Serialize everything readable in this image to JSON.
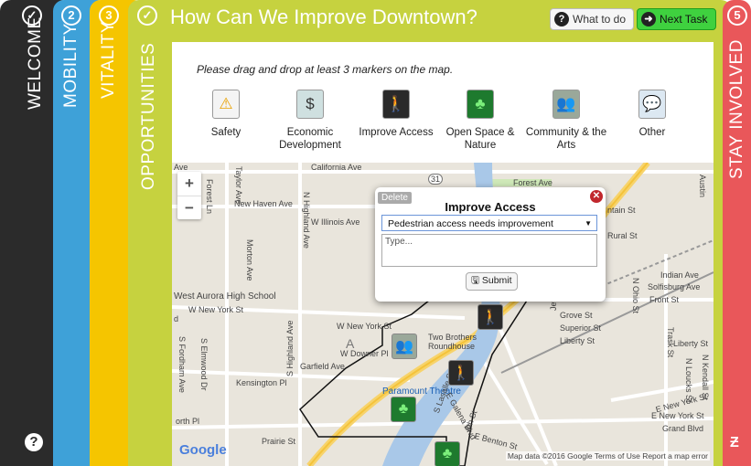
{
  "tabs": {
    "welcome": {
      "num": "✓",
      "label": "WELCOME"
    },
    "mobility": {
      "num": "2",
      "label": "MOBILITY"
    },
    "vitality": {
      "num": "3",
      "label": "VITALITY"
    },
    "opportunities": {
      "num": "✓",
      "label": "OPPORTUNITIES"
    },
    "stay": {
      "num": "5",
      "label": "STAY INVOLVED"
    }
  },
  "header": {
    "title": "How Can We Improve Downtown?",
    "what_to_do": "What to do",
    "next_task": "Next Task"
  },
  "instructions": "Please drag and drop at least 3 markers on the map.",
  "markers": [
    {
      "label": "Safety",
      "icon": "warning-icon"
    },
    {
      "label": "Economic Development",
      "icon": "dollar-icon"
    },
    {
      "label": "Improve Access",
      "icon": "pedestrian-icon"
    },
    {
      "label": "Open Space & Nature",
      "icon": "tree-icon"
    },
    {
      "label": "Community & the Arts",
      "icon": "people-icon"
    },
    {
      "label": "Other",
      "icon": "speech-bubble-icon"
    }
  ],
  "popup": {
    "delete": "Delete",
    "title": "Improve Access",
    "selected": "Pedestrian access needs improvement",
    "placeholder": "Type...",
    "submit": "Submit"
  },
  "map": {
    "zoom_in": "+",
    "zoom_out": "−",
    "labels": {
      "ave": "Ave",
      "taylor": "Taylor Ave",
      "forest_ln": "Forest Ln",
      "california": "California Ave",
      "route31": "31",
      "forest_ave": "Forest Ave",
      "austin": "Austin",
      "new_haven": "New Haven Ave",
      "n_highland": "N Highland Ave",
      "illinois": "W Illinois Ave",
      "ntain": "ntain St",
      "rural": "Rural St",
      "morton": "Morton Ave",
      "indian": "Indian Ave",
      "solfisburg": "Solfisburg Ave",
      "n_ohio": "N Ohio St",
      "front": "Front St",
      "west_aurora": "West Aurora High School",
      "w_new_york_1": "W New York St",
      "d": "d",
      "w_new_york_2": "W New York St",
      "grove": "Grove St",
      "superior": "Superior St",
      "liberty_1": "Liberty St",
      "jefferson": "Jefferson St",
      "trask": "Trask St",
      "liberty_2": "Liberty St",
      "s_fordham": "S Fordham Ave",
      "s_elmwood": "S Elmwood Dr",
      "w_downer": "W Downer Pl",
      "two_brothers": "Two Brothers Roundhouse",
      "garfield": "Garfield Ave",
      "a": "A",
      "n_kendall": "N Kendall St",
      "n_loucks": "N Loucks St",
      "kensington": "Kensington Pl",
      "s_highland": "S Highland Ave",
      "paramount": "Paramount Theatre",
      "e_new_york": "E New York St",
      "e_new_york_2": "E New York St",
      "grand": "Grand Blvd",
      "orth_pl": "orth Pl",
      "prairie": "Prairie St",
      "s_lasalle": "S Lasalle St",
      "e_galena": "E Galena Blvd",
      "fourth": "4th St",
      "e_benton": "E Benton St"
    },
    "google": "Google",
    "footer": "Map data ©2016 Google   Terms of Use   Report a map error"
  },
  "colors": {
    "welcome": "#2b2b2b",
    "mobility": "#3ea1d8",
    "vitality": "#f5c500",
    "opportunities": "#c6d23f",
    "stay": "#e9575a",
    "next_button": "#3fd13f"
  }
}
